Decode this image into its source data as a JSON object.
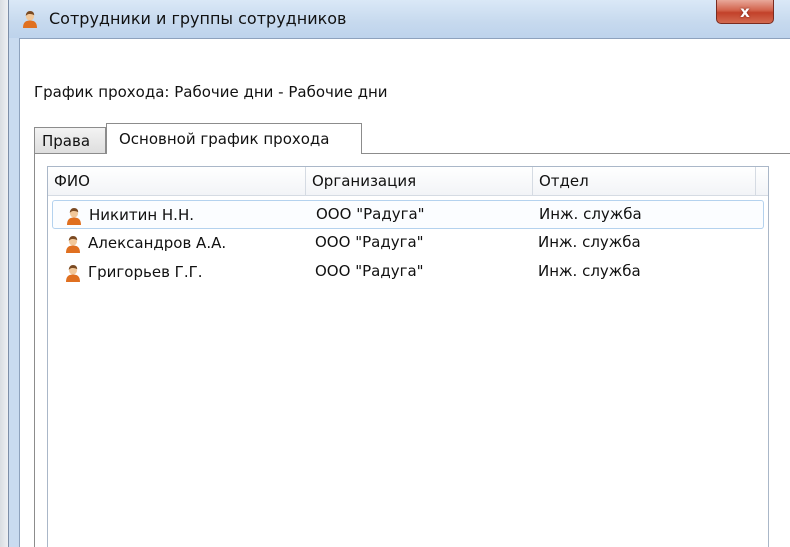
{
  "window": {
    "title": "Сотрудники и группы сотрудников",
    "close_label": "x"
  },
  "schedule_label": "График прохода: Рабочие дни - Рабочие дни",
  "tabs": [
    {
      "label": "Права",
      "selected": false
    },
    {
      "label": "Основной график прохода",
      "selected": true
    }
  ],
  "grid": {
    "columns": [
      "ФИО",
      "Организация",
      "Отдел"
    ],
    "rows": [
      {
        "fio": "Никитин Н.Н.",
        "org": "ООО \"Радуга\"",
        "dept": "Инж. служба",
        "icon": "person-icon",
        "selected": true
      },
      {
        "fio": "Александров А.А.",
        "org": "ООО \"Радуга\"",
        "dept": "Инж. служба",
        "icon": "person-icon",
        "selected": false
      },
      {
        "fio": "Григорьев Г.Г.",
        "org": "ООО \"Радуга\"",
        "dept": "Инж. служба",
        "icon": "person-icon",
        "selected": false
      }
    ]
  },
  "colors": {
    "title_bar": "#c6d9ee",
    "close_button": "#c2412a",
    "selection_border": "#b4d2ee"
  }
}
